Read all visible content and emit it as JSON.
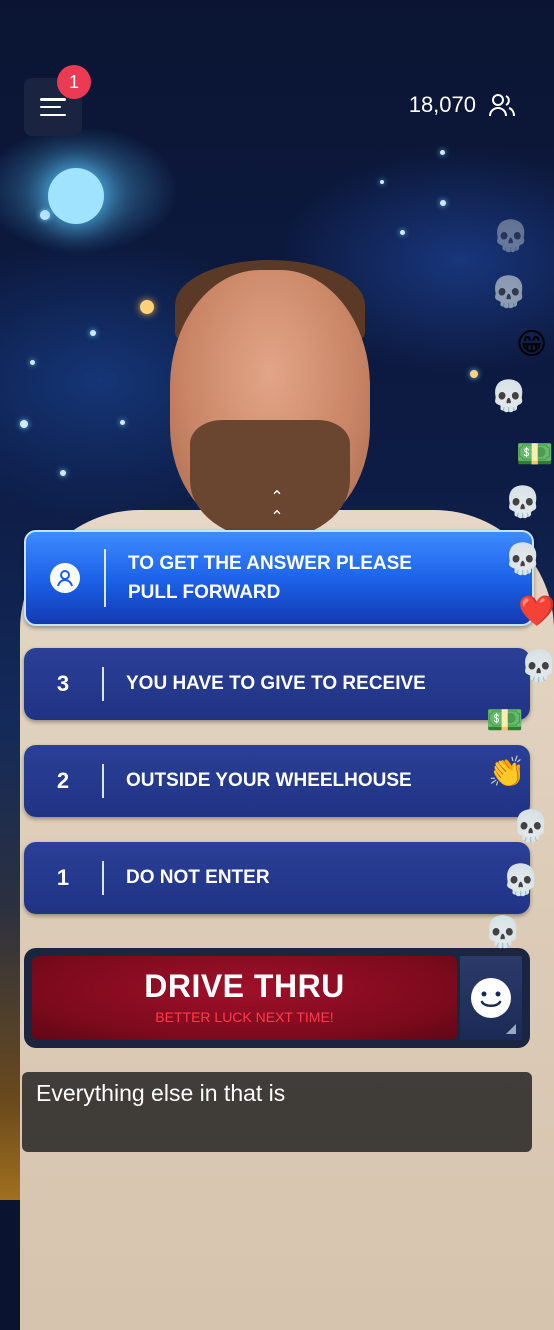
{
  "header": {
    "notification_count": "1",
    "viewer_count": "18,070"
  },
  "answers": [
    {
      "num": "",
      "text_line1": "TO GET THE ANSWER PLEASE",
      "text_line2": "PULL FORWARD",
      "selected": true
    },
    {
      "num": "3",
      "text": "YOU HAVE TO GIVE TO RECEIVE"
    },
    {
      "num": "2",
      "text": "OUTSIDE YOUR WHEELHOUSE"
    },
    {
      "num": "1",
      "text": "DO NOT ENTER"
    }
  ],
  "result": {
    "title": "DRIVE THRU",
    "subtitle": "BETTER LUCK NEXT TIME!"
  },
  "caption": {
    "text": "Everything else in that is"
  },
  "colors": {
    "answer_bg": "#203385",
    "selected_bg": "#1a5fe6",
    "result_bg": "#7b0a1c",
    "subtitle": "#ff3b4a",
    "badge": "#ec3a54"
  },
  "icons": {
    "menu": "menu-icon",
    "viewers": "viewers-icon",
    "user": "user-circle-icon",
    "react": "smile-icon"
  }
}
